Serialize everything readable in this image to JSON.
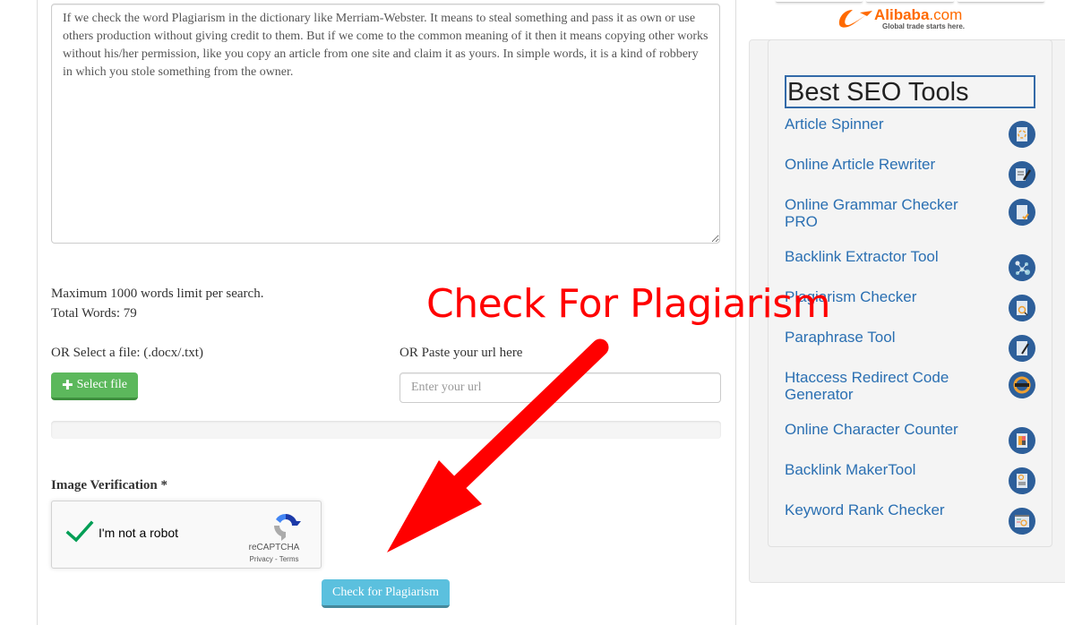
{
  "editor": {
    "text": "If we check the word Plagiarism in the dictionary like Merriam-Webster. It means to steal something and pass it as own or use others production without giving credit to them. But if we come to the common meaning of it then it means copying other works without his/her permission, like you copy an article from one site and claim it as yours. In simple words, it is a kind of robbery in which you stole something from the owner."
  },
  "info": {
    "limit_text": "Maximum 1000 words limit per search.",
    "total_words_label": "Total Words: 79"
  },
  "file_upload": {
    "label": "OR Select a file: (.docx/.txt)",
    "button_label": "Select file",
    "icon": "plus-icon"
  },
  "url_input": {
    "label": "OR Paste your url here",
    "placeholder": "Enter your url",
    "value": ""
  },
  "progress": {
    "percent": 0
  },
  "verification": {
    "label": "Image Verification *",
    "captcha_text": "I'm not a robot",
    "captcha_brand": "reCAPTCHA",
    "captcha_links": "Privacy - Terms",
    "checked": true
  },
  "submit": {
    "label": "Check for Plagiarism"
  },
  "ad": {
    "brand": "Alibaba",
    "brand_suffix": ".com",
    "tagline": "Global trade starts here."
  },
  "seo_tools": {
    "title": "Best SEO Tools",
    "items": [
      {
        "label": "Article Spinner",
        "icon": "spinner-doc-icon"
      },
      {
        "label": "Online Article Rewriter",
        "icon": "scroll-pen-icon"
      },
      {
        "label": "Online Grammar Checker PRO",
        "icon": "doc-check-icon"
      },
      {
        "label": "Backlink Extractor Tool",
        "icon": "network-icon"
      },
      {
        "label": "Plagiarism Checker",
        "icon": "doc-magnifier-icon"
      },
      {
        "label": "Paraphrase Tool",
        "icon": "doc-pencil-icon"
      },
      {
        "label": "Htaccess Redirect Code Generator",
        "icon": "htaccess-redirect-icon"
      },
      {
        "label": "Online Character Counter",
        "icon": "calculator-icon"
      },
      {
        "label": "Backlink MakerTool",
        "icon": "link-doc-icon"
      },
      {
        "label": "Keyword Rank Checker",
        "icon": "browser-search-icon"
      }
    ]
  },
  "annotation": {
    "text": "Check For Plagiarism",
    "color": "#ff0000"
  },
  "colors": {
    "select_button": "#5cb85c",
    "check_button": "#5bc0de",
    "link": "#2a6fb2",
    "icon_bg": "#2d5f9a",
    "title_border": "#336aa8"
  }
}
